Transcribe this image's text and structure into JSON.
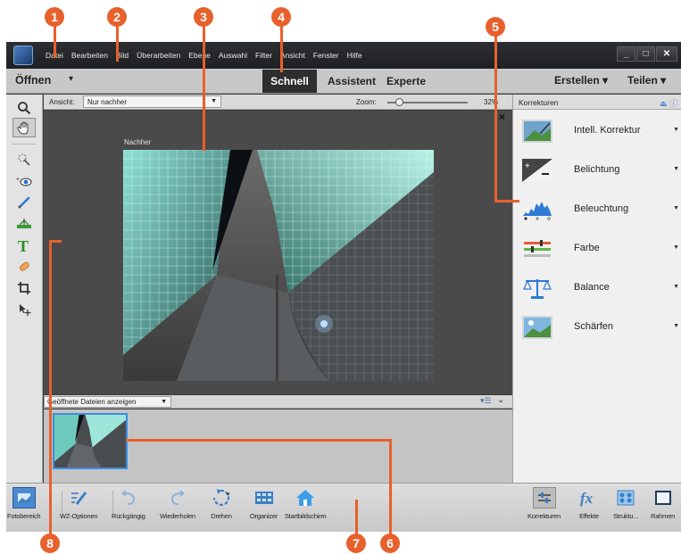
{
  "callouts": [
    "1",
    "2",
    "3",
    "4",
    "5",
    "6",
    "7",
    "8"
  ],
  "menubar": {
    "items": [
      "Datei",
      "Bearbeiten",
      "Bild",
      "Überarbeiten",
      "Ebene",
      "Auswahl",
      "Filter",
      "Ansicht",
      "Fenster",
      "Hilfe"
    ],
    "window_controls": [
      "_",
      "□",
      "✕"
    ]
  },
  "modebar": {
    "open_label": "Öffnen",
    "open_dropdown": "▾",
    "tabs": [
      "Schnell",
      "Assistent",
      "Experte"
    ],
    "active_tab": "Schnell",
    "create_label": "Erstellen ▾",
    "share_label": "Teilen ▾"
  },
  "options": {
    "view_label": "Ansicht:",
    "view_value": "Nur nachher",
    "zoom_label": "Zoom:",
    "zoom_value": "32%",
    "zoom_level_percent": 32
  },
  "canvas": {
    "close_icon": "×",
    "after_label": "Nachher"
  },
  "bin": {
    "select_value": "Geöffnete Dateien anzeigen"
  },
  "panel": {
    "title": "Korrekturen",
    "items": [
      "Intell. Korrektur",
      "Belichtung",
      "Beleuchtung",
      "Farbe",
      "Balance",
      "Schärfen"
    ]
  },
  "taskbar": {
    "items": [
      "Fotobereich",
      "WZ-Optionen",
      "Rückgängig",
      "Wiederholen",
      "Drehen",
      "Organizer",
      "Startbildschirm",
      "Korrekturen",
      "Effekte",
      "Struktu...",
      "Rahmen"
    ]
  },
  "colors": {
    "accent": "#e8602c",
    "selection": "#3b8ee0",
    "active_tab_bg": "#2e2e2e"
  }
}
